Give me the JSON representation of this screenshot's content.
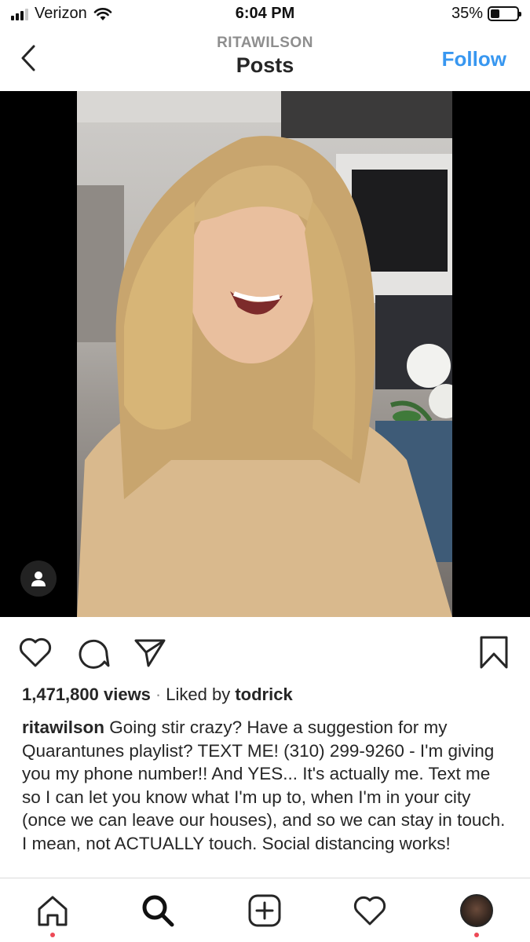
{
  "status_bar": {
    "carrier": "Verizon",
    "time": "6:04 PM",
    "battery_percent_label": "35%",
    "battery_level": 0.35,
    "icons": [
      "signal-icon",
      "wifi-icon",
      "battery-icon"
    ]
  },
  "header": {
    "username": "RITAWILSON",
    "title": "Posts",
    "follow_label": "Follow",
    "accent_color": "#3897f0"
  },
  "post": {
    "views_count": "1,471,800 views",
    "separator": "·",
    "liked_by_prefix": "Liked by",
    "liked_by_user": "todrick",
    "caption_user": "ritawilson",
    "caption_text": "Going stir crazy? Have a suggestion for my Quarantunes playlist? TEXT ME! (310) 299-9260 - I'm giving you my phone number!! And YES... It's actually me. Text me so I can let you know what I'm up to, when I'm in your city (once we can leave our houses), and so we can stay in touch. I mean, not ACTUALLY touch. Social distancing works!"
  },
  "actions": [
    "heart-icon",
    "comment-icon",
    "share-icon",
    "bookmark-icon"
  ],
  "tab_bar": {
    "items": [
      "home-icon",
      "search-icon",
      "new-post-icon",
      "activity-icon",
      "profile-avatar"
    ],
    "notification_color": "#ed4956"
  }
}
